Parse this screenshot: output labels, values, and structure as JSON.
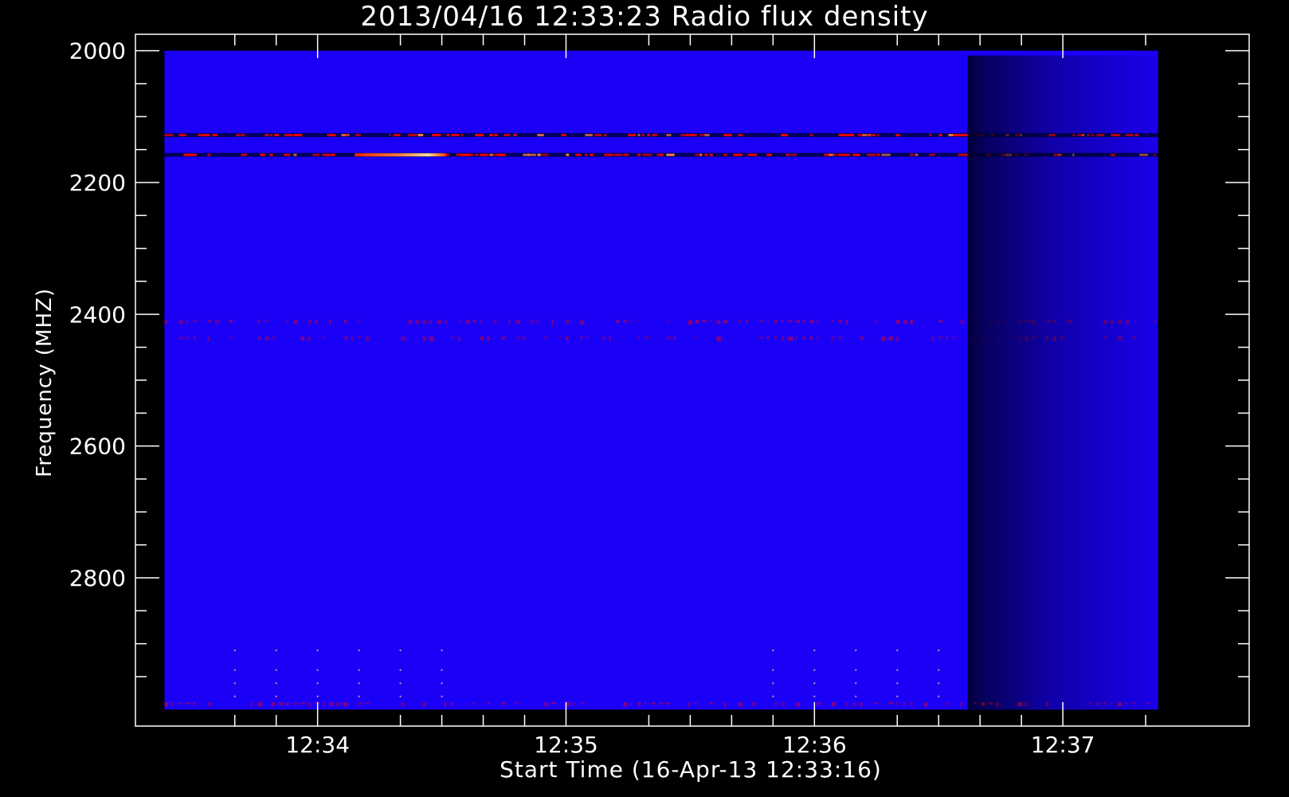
{
  "chart_data": {
    "type": "heatmap",
    "title": "2013/04/16 12:33:23 Radio flux density",
    "xlabel": "Start Time (16-Apr-13 12:33:16)",
    "ylabel": "Frequency (MHZ)",
    "x_unit": "time",
    "y_unit": "MHz",
    "y_inverted": true,
    "xlim": [
      "12:33:16",
      "12:37:45"
    ],
    "ylim": [
      1975,
      3025
    ],
    "data_extent": {
      "x": [
        "12:33:23",
        "12:37:23"
      ],
      "y": [
        2000,
        3000
      ]
    },
    "x_major_ticks": [
      "12:34",
      "12:35",
      "12:36",
      "12:37"
    ],
    "x_minor_ticks": [
      "12:33:40",
      "12:33:50",
      "12:34:20",
      "12:34:30",
      "12:34:40",
      "12:34:50",
      "12:35:20",
      "12:35:30",
      "12:35:40",
      "12:35:50",
      "12:36:20",
      "12:36:30",
      "12:36:40",
      "12:36:50",
      "12:37:20"
    ],
    "y_major_ticks": [
      2000,
      2200,
      2400,
      2600,
      2800
    ],
    "y_minor_ticks": [
      2050,
      2100,
      2150,
      2250,
      2300,
      2350,
      2450,
      2500,
      2550,
      2650,
      2700,
      2750,
      2850,
      2900,
      2950
    ],
    "colormap": {
      "background": "#1a00f5",
      "low": "#000040",
      "mid": "#ff0000",
      "high": "#ffff80"
    },
    "features": [
      {
        "kind": "horizontal_band",
        "freq_mhz": 2128,
        "intensity": "high"
      },
      {
        "kind": "horizontal_band",
        "freq_mhz": 2158,
        "intensity": "high"
      },
      {
        "kind": "hot_spot",
        "freq_mhz": 2158,
        "time_range": [
          "12:34:09",
          "12:34:31"
        ],
        "intensity": "very-high"
      },
      {
        "kind": "dotted_band",
        "freq_mhz": 2410,
        "intensity": "low"
      },
      {
        "kind": "dotted_band",
        "freq_mhz": 2435,
        "intensity": "low"
      },
      {
        "kind": "dark_column",
        "time_range": [
          "12:36:37",
          "12:37:23"
        ],
        "intensity": "reduced"
      },
      {
        "kind": "dotted_band",
        "freq_mhz": 2990,
        "intensity": "low"
      }
    ]
  }
}
